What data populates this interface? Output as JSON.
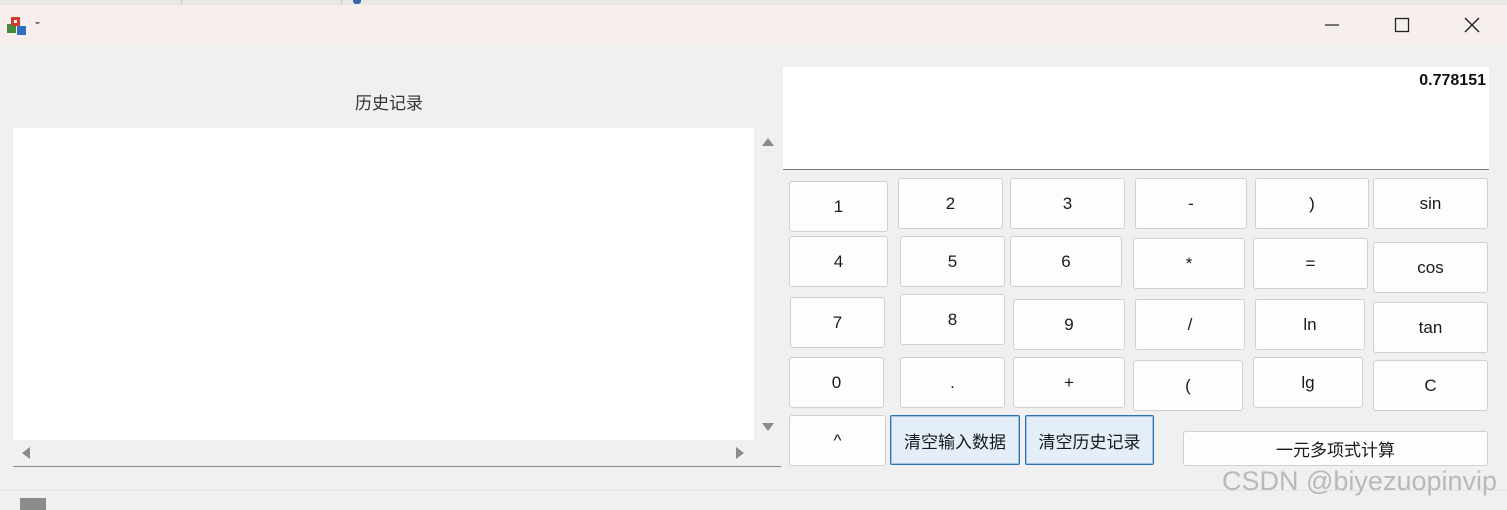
{
  "window": {
    "title": "-",
    "controls": {
      "minimize": "minimize-icon",
      "maximize": "maximize-icon",
      "close": "close-icon"
    }
  },
  "history": {
    "label": "历史记录",
    "entries": []
  },
  "display": {
    "value": "0.778151"
  },
  "keypad": {
    "row1": [
      "1",
      "2",
      "3",
      "-",
      ")",
      "sin"
    ],
    "row2": [
      "4",
      "5",
      "6",
      "*",
      "=",
      "cos"
    ],
    "row3": [
      "7",
      "8",
      "9",
      "/",
      "ln",
      "tan"
    ],
    "row4": [
      "0",
      ".",
      "+",
      "(",
      "lg",
      "C"
    ],
    "row5": [
      "^",
      "清空输入数据",
      "清空历史记录",
      "一元多项式计算"
    ]
  },
  "watermark": "CSDN @biyezuopinvip",
  "colors": {
    "focus_border": "#2f6fb0",
    "focus_bg": "#e3eef8"
  }
}
